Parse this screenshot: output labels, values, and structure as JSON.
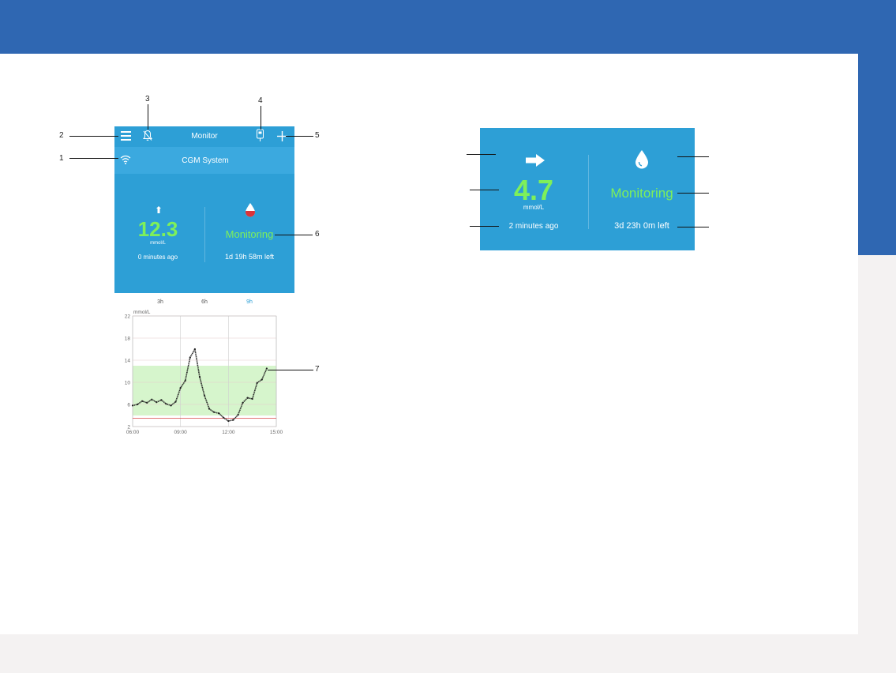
{
  "phone": {
    "nav_title": "Monitor",
    "status_label": "CGM System",
    "glucose_value": "12.3",
    "glucose_unit": "mmol/L",
    "reading_age": "0 minutes ago",
    "sensor_state": "Monitoring",
    "sensor_time_left": "1d 19h 58m left",
    "icons": {
      "menu": "menu-icon",
      "alarm": "bell-off-icon",
      "transmitter": "transmitter-icon",
      "add": "plus-icon",
      "wifi": "wifi-icon",
      "trend": "trend-up-icon",
      "drop": "blood-drop-icon"
    }
  },
  "callouts": {
    "c1": "1",
    "c2": "2",
    "c3": "3",
    "c4": "4",
    "c5": "5",
    "c6": "6",
    "c7": "7"
  },
  "chart_tabs": [
    "3h",
    "6h",
    "9h"
  ],
  "chart_active_tab": "9h",
  "detail": {
    "glucose_value": "4.7",
    "glucose_unit": "mmol/L",
    "reading_age": "2 minutes ago",
    "sensor_state": "Monitoring",
    "sensor_time_left": "3d 23h 0m left",
    "icons": {
      "trend": "arrow-right-icon",
      "drop": "water-drop-icon"
    }
  },
  "colors": {
    "header_blue": "#2f67b2",
    "panel_blue": "#2d9fd6",
    "glucose_green": "#7ef05a",
    "target_band": "#d6f5cc",
    "low_line": "#d94a4a"
  },
  "chart_data": {
    "type": "line",
    "ylabel": "mmol/L",
    "x_ticks": [
      "06:00",
      "09:00",
      "12:00",
      "15:00"
    ],
    "y_ticks": [
      2,
      6,
      10,
      14,
      18,
      22
    ],
    "xlim": [
      6,
      15
    ],
    "ylim": [
      2,
      22
    ],
    "target_range": [
      4,
      13
    ],
    "low_threshold": 3.5,
    "x": [
      6.0,
      6.3,
      6.6,
      6.9,
      7.2,
      7.5,
      7.8,
      8.1,
      8.4,
      8.7,
      9.0,
      9.3,
      9.6,
      9.9,
      10.2,
      10.5,
      10.8,
      11.1,
      11.4,
      11.7,
      12.0,
      12.3,
      12.6,
      12.9,
      13.2,
      13.5,
      13.8,
      14.1,
      14.4
    ],
    "y": [
      5.8,
      6.0,
      6.6,
      6.3,
      6.9,
      6.4,
      6.8,
      6.1,
      5.8,
      6.5,
      9.0,
      10.3,
      14.5,
      16.0,
      11.0,
      7.6,
      5.2,
      4.6,
      4.4,
      3.6,
      3.0,
      3.2,
      4.1,
      6.3,
      7.2,
      7.0,
      9.9,
      10.5,
      12.5
    ]
  }
}
